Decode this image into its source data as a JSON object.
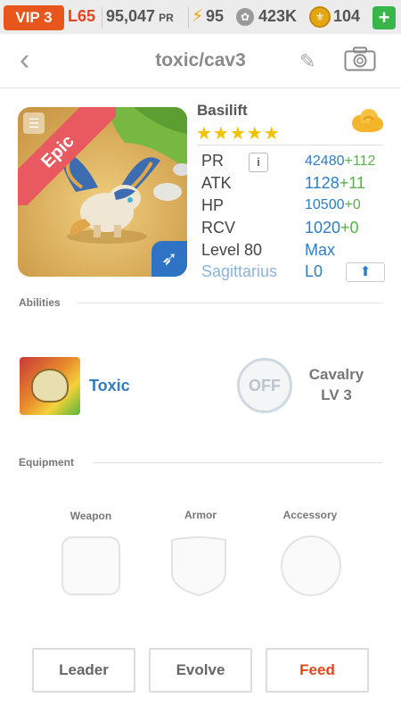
{
  "status_bar": {
    "vip": "VIP 3",
    "level": "L65",
    "pr": "95,047",
    "pr_unit": "PR",
    "energy": "95",
    "food": "423K",
    "gold": "104",
    "add_label": "+"
  },
  "header": {
    "back_label": "‹",
    "title": "toxic/cav3"
  },
  "monster": {
    "rarity": "Epic",
    "name": "Basilift",
    "stars": "★★★★★",
    "stats": {
      "pr_label": "PR",
      "pr_value": "42480",
      "pr_bonus": "+112",
      "info_label": "i",
      "atk_label": "ATK",
      "atk_value": "1128",
      "atk_bonus": "+11",
      "hp_label": "HP",
      "hp_value": "10500",
      "hp_bonus": "+0",
      "rcv_label": "RCV",
      "rcv_value": "1020",
      "rcv_bonus": "+0",
      "level_label": "Level 80",
      "level_value": "Max",
      "sign_label": "Sagittarius",
      "sign_value": "L0"
    }
  },
  "abilities": {
    "section_title": "Abilities",
    "ability_name": "Toxic",
    "off_label": "OFF",
    "cavalry_title": "Cavalry",
    "cavalry_level": "LV 3"
  },
  "equipment": {
    "section_title": "Equipment",
    "weapon_label": "Weapon",
    "armor_label": "Armor",
    "accessory_label": "Accessory"
  },
  "actions": {
    "leader": "Leader",
    "evolve": "Evolve",
    "feed": "Feed"
  },
  "colors": {
    "accent_orange": "#e4451b",
    "accent_blue": "#2f7cc4",
    "bonus_green": "#5ab04a",
    "epic_ribbon": "#e85a60",
    "star_gold": "#f2c200"
  }
}
